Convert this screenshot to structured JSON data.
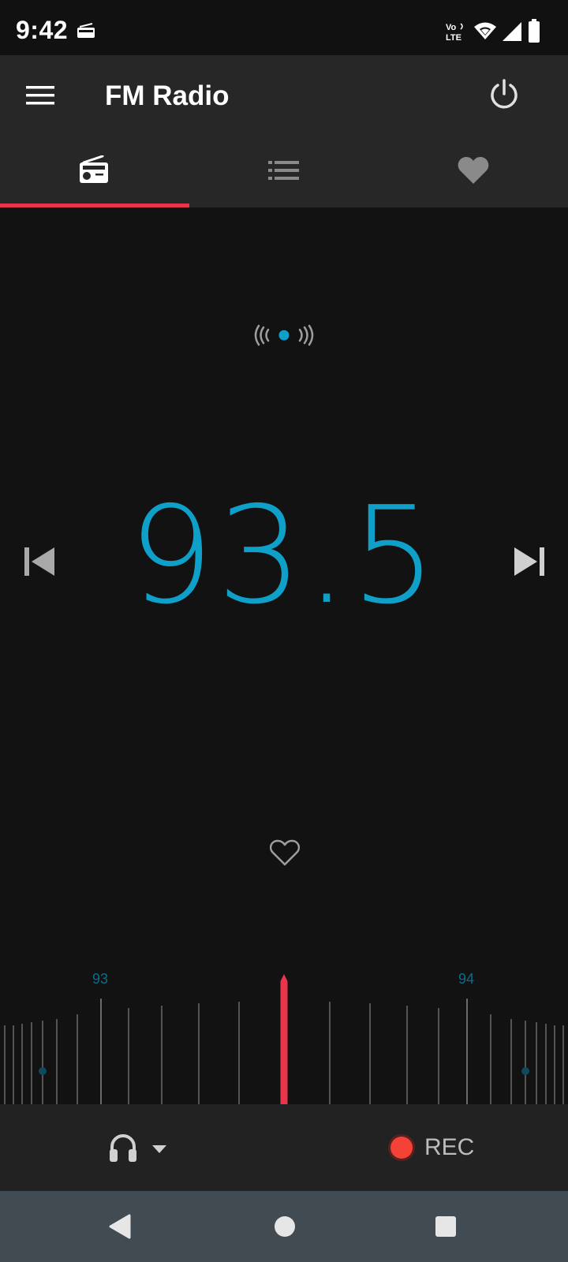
{
  "status_bar": {
    "time": "9:42",
    "network_label": "Vo LTE",
    "icons": [
      "radio-notification-icon",
      "volte-icon",
      "wifi-icon",
      "cell-signal-icon",
      "battery-icon"
    ]
  },
  "app_bar": {
    "title": "FM Radio",
    "menu_icon": "hamburger-menu-icon",
    "power_icon": "power-icon"
  },
  "tabs": [
    {
      "icon": "radio-icon",
      "selected": true
    },
    {
      "icon": "list-icon",
      "selected": false
    },
    {
      "icon": "heart-filled-icon",
      "selected": false
    }
  ],
  "player": {
    "frequency": "93.5",
    "signal_icon": "broadcast-signal-icon",
    "favorite_icon": "heart-outline-icon",
    "prev_icon": "skip-previous-icon",
    "next_icon": "skip-next-icon"
  },
  "tuner": {
    "labels": [
      "93",
      "94"
    ],
    "indicator_color": "#e8354c"
  },
  "bottom_bar": {
    "audio_output_icon": "headphones-icon",
    "dropdown_icon": "dropdown-arrow-icon",
    "rec_label": "REC",
    "rec_color": "#f44336"
  },
  "nav_bar": {
    "back_icon": "back-icon",
    "home_icon": "home-icon",
    "recents_icon": "recents-icon"
  },
  "colors": {
    "accent": "#0fa0c9",
    "indicator": "#e8354c",
    "background": "#121212",
    "toolbar": "#272727"
  }
}
